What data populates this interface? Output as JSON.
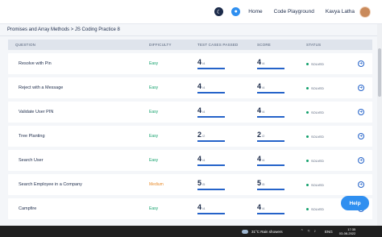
{
  "nav": {
    "home": "Home",
    "code_playground": "Code Playground",
    "username": "Kavya Latha"
  },
  "breadcrumb": "Promises and Array Methods > JS Coding Practice 8",
  "table": {
    "headers": {
      "question": "QUESTION",
      "difficulty": "DIFFICULTY",
      "test_cases": "TEST CASES PASSED",
      "score": "SCORE",
      "status": "STATUS"
    },
    "rows": [
      {
        "question": "Resolve with Pin",
        "difficulty": "Easy",
        "passed": "4",
        "total": "/4",
        "score": "4",
        "score_total": "/4",
        "status": "SOLVED"
      },
      {
        "question": "Reject with a Message",
        "difficulty": "Easy",
        "passed": "4",
        "total": "/4",
        "score": "4",
        "score_total": "/4",
        "status": "SOLVED"
      },
      {
        "question": "Validate User PIN",
        "difficulty": "Easy",
        "passed": "4",
        "total": "/4",
        "score": "4",
        "score_total": "/4",
        "status": "SOLVED"
      },
      {
        "question": "Tree Planting",
        "difficulty": "Easy",
        "passed": "2",
        "total": "/2",
        "score": "2",
        "score_total": "/2",
        "status": "SOLVED"
      },
      {
        "question": "Search User",
        "difficulty": "Easy",
        "passed": "4",
        "total": "/4",
        "score": "4",
        "score_total": "/4",
        "status": "SOLVED"
      },
      {
        "question": "Search Employee in a Company",
        "difficulty": "Medium",
        "passed": "5",
        "total": "/5",
        "score": "5",
        "score_total": "/5",
        "status": "SOLVED"
      },
      {
        "question": "Campfire",
        "difficulty": "Easy",
        "passed": "4",
        "total": "/4",
        "score": "4",
        "score_total": "/4",
        "status": "SOLVED"
      }
    ]
  },
  "help_label": "Help",
  "taskbar": {
    "weather": "31°C Rain showers",
    "lang": "ENG",
    "time": "17:35",
    "date": "03-08-2022"
  },
  "colors": {
    "accent": "#2563c9",
    "easy": "#12a06b",
    "medium": "#e88a28",
    "help": "#2f8ff0"
  }
}
